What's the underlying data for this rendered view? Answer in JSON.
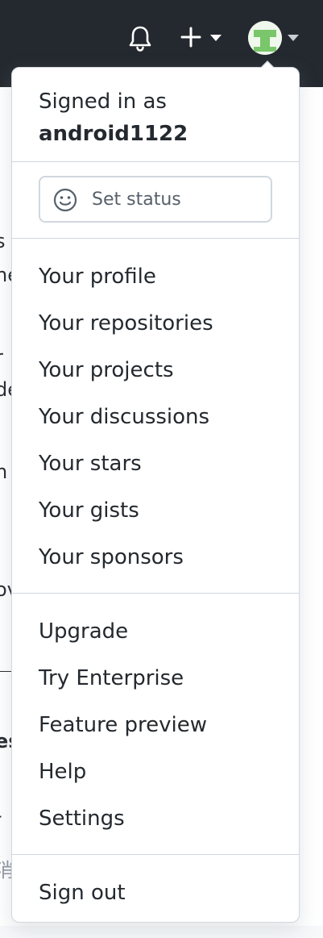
{
  "header": {
    "icons": [
      "bell-icon",
      "plus-icon",
      "caret-down-icon",
      "avatar",
      "caret-down-icon"
    ],
    "background_color": "#24292f"
  },
  "background": {
    "lines": [
      "s",
      "ne",
      "r",
      "de",
      "h",
      "ov",
      "es",
      "-",
      "消"
    ]
  },
  "dropdown": {
    "signed_in_label": "Signed in as",
    "username": "android1122",
    "status_placeholder": "Set status",
    "profile_items": [
      "Your profile",
      "Your repositories",
      "Your projects",
      "Your discussions",
      "Your stars",
      "Your gists",
      "Your sponsors"
    ],
    "secondary_items": [
      "Upgrade",
      "Try Enterprise",
      "Feature preview",
      "Help",
      "Settings"
    ],
    "sign_out_label": "Sign out"
  },
  "colors": {
    "avatar_green": "#7ac66a",
    "border": "#d0d7de",
    "text": "#24292f",
    "muted": "#57606a"
  }
}
